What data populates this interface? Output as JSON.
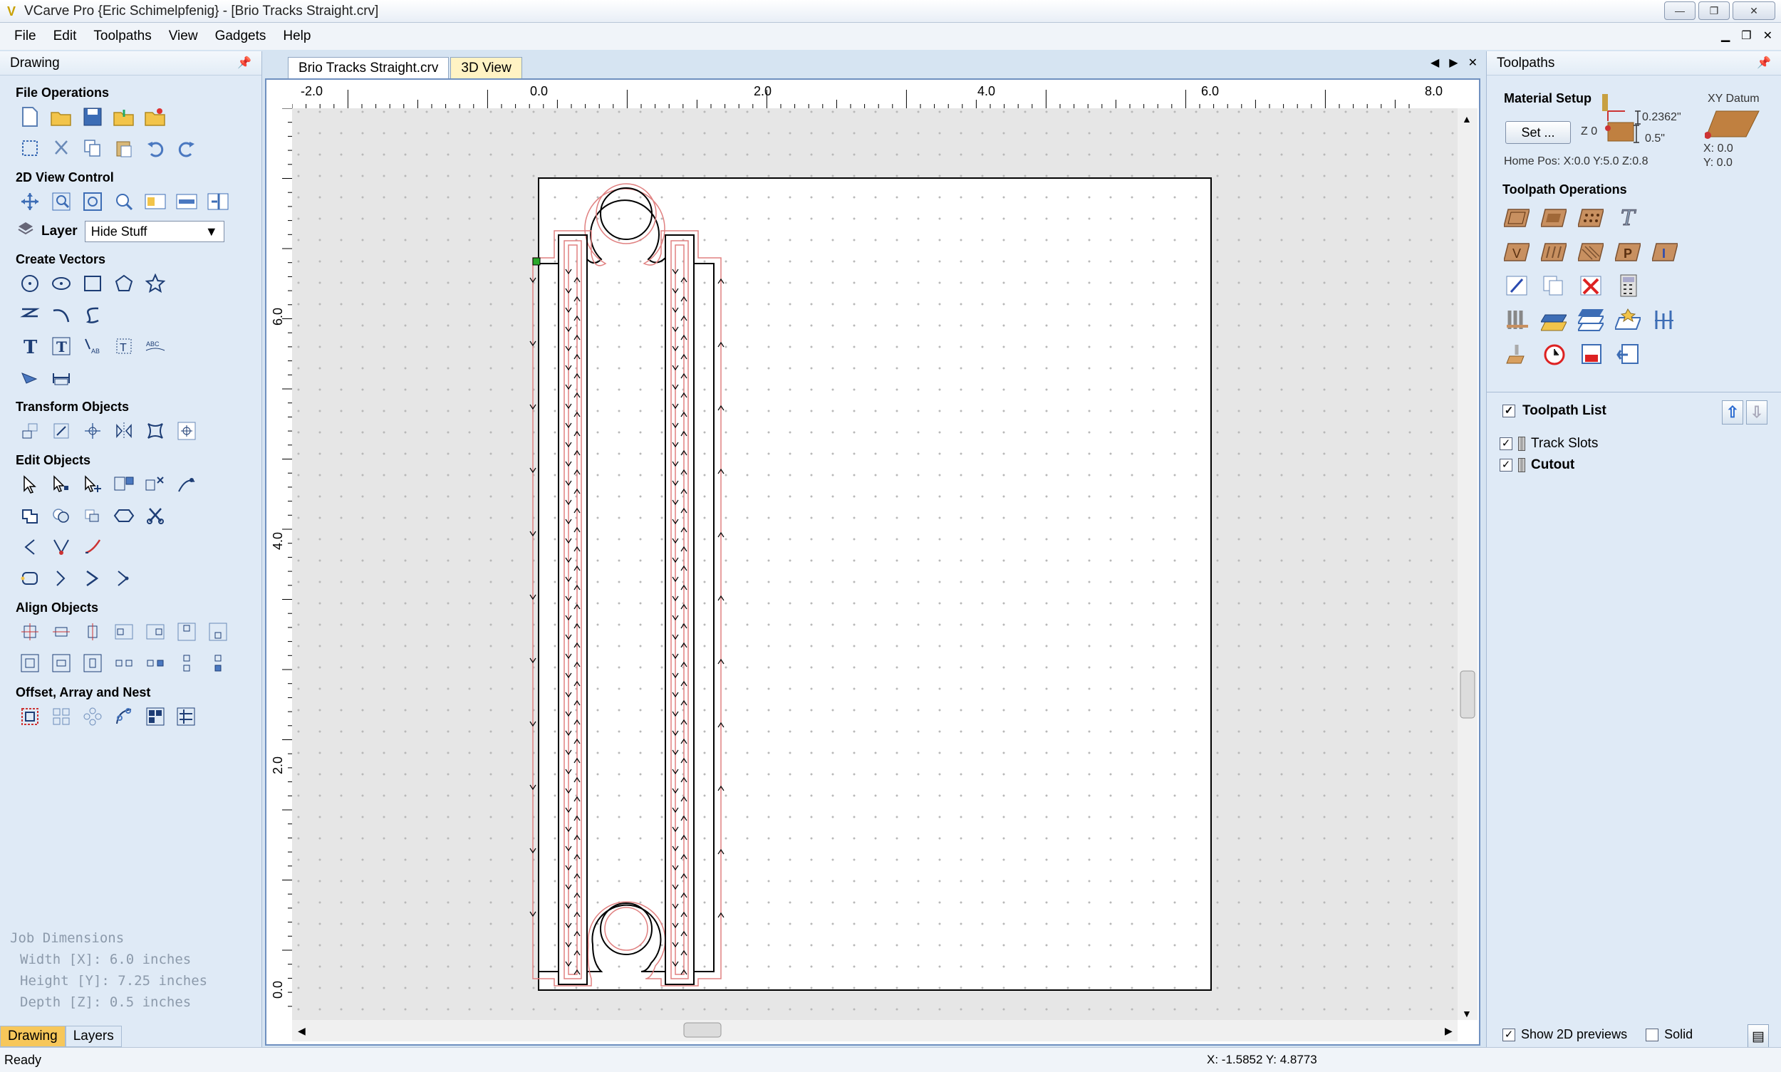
{
  "window": {
    "title": "VCarve Pro {Eric Schimelpfenig} - [Brio Tracks Straight.crv]",
    "buttons": [
      "—",
      "❐",
      "✕"
    ]
  },
  "menu": [
    "File",
    "Edit",
    "Toolpaths",
    "View",
    "Gadgets",
    "Help"
  ],
  "left_panel": {
    "title": "Drawing",
    "sections": {
      "file_ops": "File Operations",
      "view_control": "2D View Control",
      "create_vectors": "Create Vectors",
      "transform": "Transform Objects",
      "edit": "Edit Objects",
      "align": "Align Objects",
      "offset": "Offset, Array and Nest"
    },
    "layer_label": "Layer",
    "layer_value": "Hide Stuff",
    "job_dimensions": {
      "title": "Job Dimensions",
      "width": "Width  [X]: 6.0 inches",
      "height": "Height [Y]: 7.25 inches",
      "depth": "Depth  [Z]: 0.5 inches"
    },
    "tabs": [
      "Drawing",
      "Layers"
    ]
  },
  "doc_tabs": [
    "Brio Tracks Straight.crv",
    "3D View"
  ],
  "ruler": {
    "x_labels": [
      "-2.0",
      "0.0",
      "2.0",
      "4.0",
      "6.0",
      "8.0"
    ],
    "y_labels": [
      "6.0",
      "4.0",
      "2.0",
      "0.0"
    ]
  },
  "right_panel": {
    "title": "Toolpaths",
    "material_setup": "Material Setup",
    "set_button": "Set ...",
    "z_label": "Z 0",
    "thickness_top": "0.2362\"",
    "thickness": "0.5\"",
    "xy_datum": "XY Datum",
    "datum_x": "X: 0.0",
    "datum_y": "Y: 0.0",
    "home_pos": "Home Pos:  X:0.0 Y:5.0 Z:0.8",
    "toolpath_operations": "Toolpath Operations",
    "toolpath_list": "Toolpath List",
    "toolpaths": [
      "Track Slots",
      "Cutout"
    ],
    "show_previews": "Show 2D previews",
    "solid": "Solid"
  },
  "status": {
    "text": "Ready",
    "coords": "X: -1.5852 Y:  4.8773"
  }
}
